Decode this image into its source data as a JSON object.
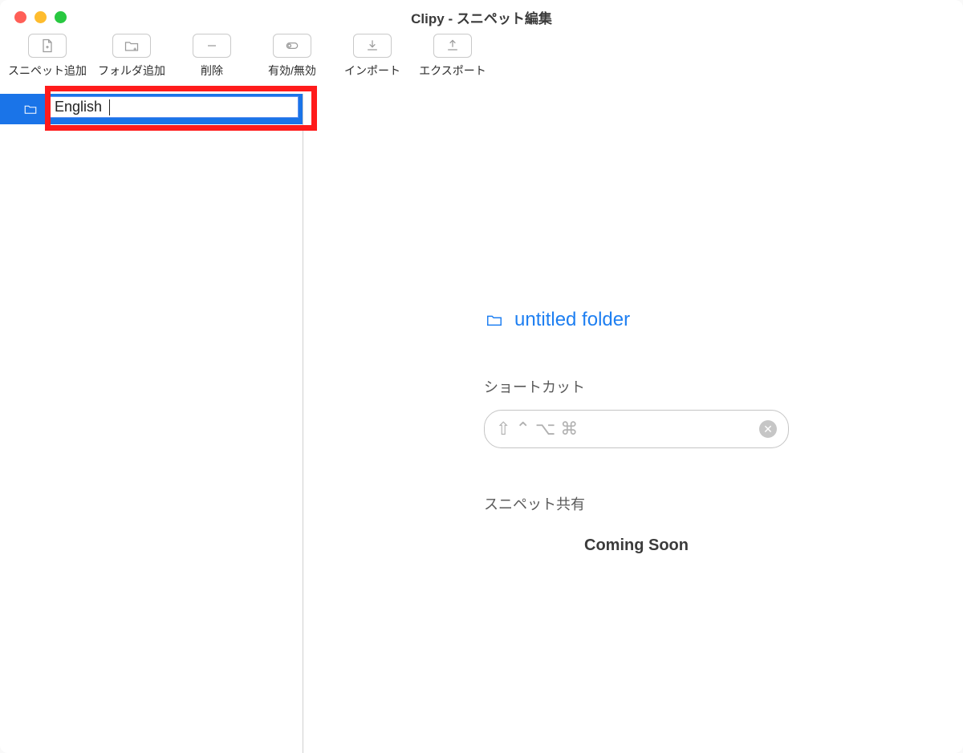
{
  "window": {
    "title": "Clipy - スニペット編集"
  },
  "toolbar": {
    "add_snippet": "スニペット追加",
    "add_folder": "フォルダ追加",
    "delete": "削除",
    "toggle": "有効/無効",
    "import": "インポート",
    "export": "エクスポート"
  },
  "sidebar": {
    "rename_value": "English"
  },
  "detail": {
    "folder_name": "untitled folder",
    "shortcut_label": "ショートカット",
    "share_label": "スニペット共有",
    "coming_soon": "Coming Soon"
  }
}
